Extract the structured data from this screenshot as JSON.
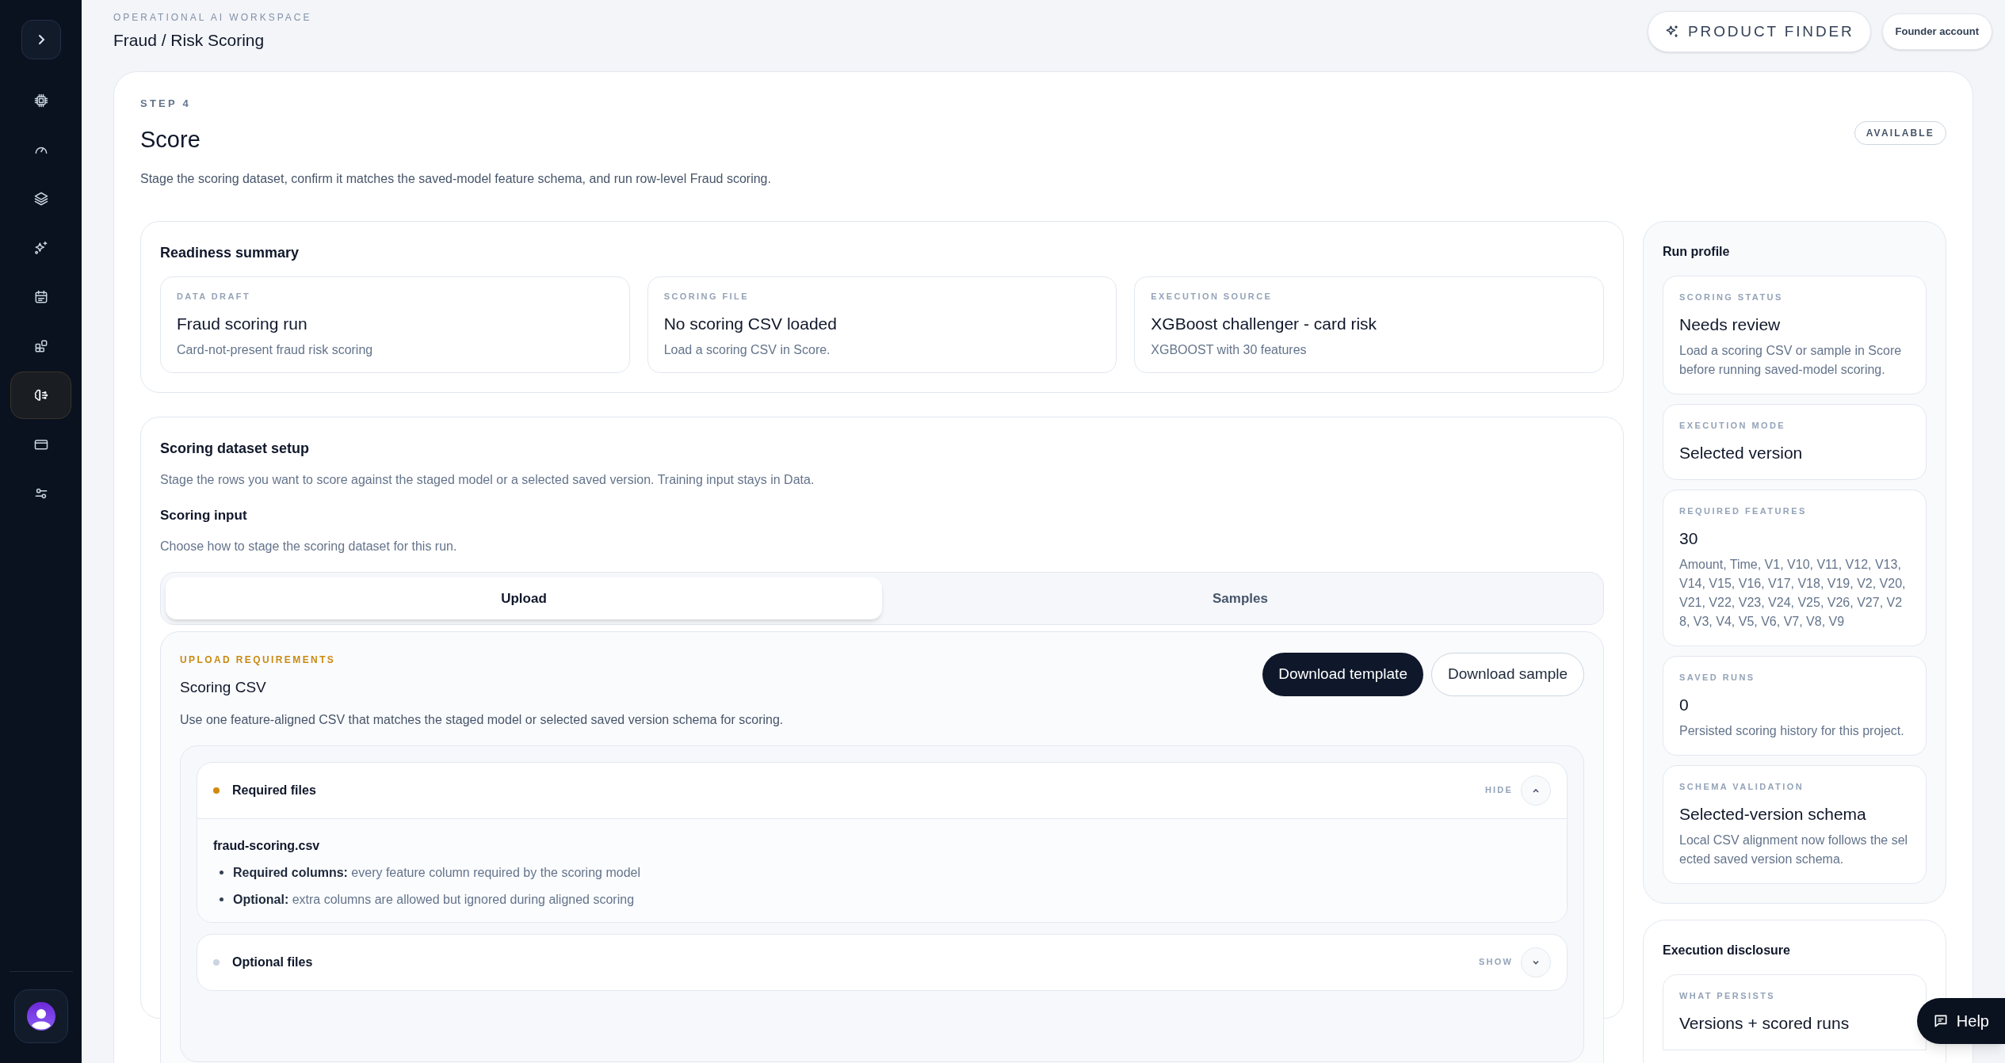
{
  "sidebar": {
    "items": [
      {
        "selected": false
      },
      {
        "selected": false
      },
      {
        "selected": false
      },
      {
        "selected": false
      },
      {
        "selected": false
      },
      {
        "selected": false
      },
      {
        "selected": true
      },
      {
        "selected": false
      },
      {
        "selected": false
      }
    ]
  },
  "header": {
    "eyebrow": "OPERATIONAL AI WORKSPACE",
    "title": "Fraud / Risk Scoring",
    "product_finder": "PRODUCT FINDER",
    "account": "Founder account"
  },
  "step": {
    "label": "STEP 4",
    "title": "Score",
    "description": "Stage the scoring dataset, confirm it matches the saved-model feature schema, and run row-level Fraud scoring.",
    "badge": "AVAILABLE"
  },
  "readiness": {
    "title": "Readiness summary",
    "cards": [
      {
        "label": "DATA DRAFT",
        "value": "Fraud scoring run",
        "detail": "Card-not-present fraud risk scoring"
      },
      {
        "label": "SCORING FILE",
        "value": "No scoring CSV loaded",
        "detail": "Load a scoring CSV in Score."
      },
      {
        "label": "EXECUTION SOURCE",
        "value": "XGBoost challenger - card risk",
        "detail": "XGBOOST with 30 features"
      }
    ]
  },
  "setup": {
    "title": "Scoring dataset setup",
    "description": "Stage the rows you want to score against the staged model or a selected saved version. Training input stays in Data.",
    "input_title": "Scoring input",
    "input_description": "Choose how to stage the scoring dataset for this run.",
    "tabs": [
      {
        "label": "Upload",
        "selected": true
      },
      {
        "label": "Samples",
        "selected": false
      }
    ]
  },
  "upload": {
    "eyebrow": "UPLOAD REQUIREMENTS",
    "title": "Scoring CSV",
    "description": "Use one feature-aligned CSV that matches the staged model or selected saved version schema for scoring.",
    "buttons": [
      {
        "label": "Download template",
        "kind": "primary"
      },
      {
        "label": "Download sample",
        "kind": "secondary"
      }
    ],
    "sections": [
      {
        "title": "Required files",
        "color": "#d08a0e",
        "expanded": true,
        "toggle": "HIDE",
        "file": "fraud-scoring.csv",
        "bullets": [
          "**Required columns:** every feature column required by the scoring model",
          "**Optional:** extra columns are allowed but ignored during aligned scoring"
        ]
      },
      {
        "title": "Optional files",
        "color": "#cbd5e1",
        "expanded": false,
        "toggle": "SHOW"
      }
    ]
  },
  "run_profile": {
    "title": "Run profile",
    "cards": [
      {
        "label": "SCORING STATUS",
        "value": "Needs review",
        "detail": "Load a scoring CSV or sample in Score before running saved-model scoring."
      },
      {
        "label": "EXECUTION MODE",
        "value": "Selected version"
      },
      {
        "label": "REQUIRED FEATURES",
        "value": "30",
        "detail": "Amount, Time, V1, V10, V11, V12, V13, V14, V15, V16, V17, V18, V19, V2, V20, V21, V22, V23, V24, V25, V26, V27, V28, V3, V4, V5, V6, V7, V8, V9"
      },
      {
        "label": "SAVED RUNS",
        "value": "0",
        "detail": "Persisted scoring history for this project."
      },
      {
        "label": "SCHEMA VALIDATION",
        "value": "Selected-version schema",
        "detail": "Local CSV alignment now follows the selected saved version schema."
      }
    ]
  },
  "disclosure": {
    "title": "Execution disclosure",
    "cards": [
      {
        "label": "WHAT PERSISTS",
        "value": "Versions + scored runs"
      }
    ]
  },
  "help": "Help"
}
